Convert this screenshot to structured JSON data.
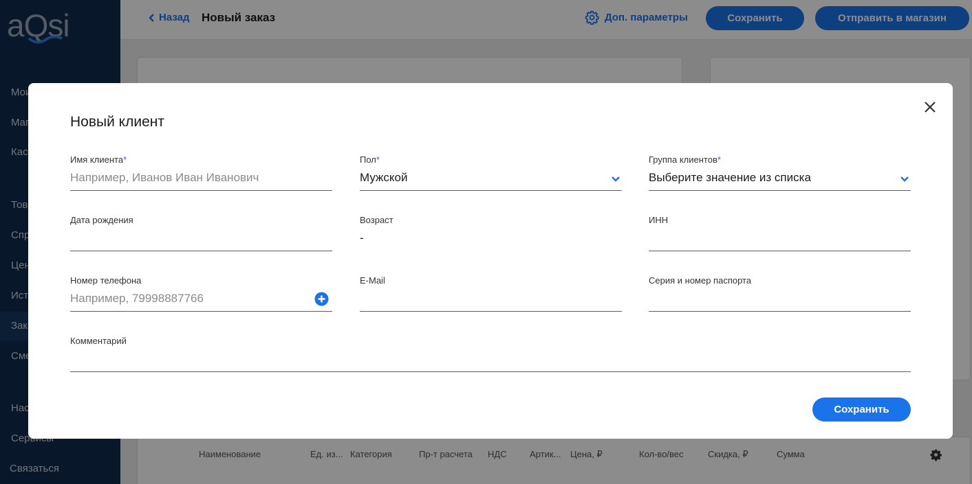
{
  "brand": {
    "logo": "aQsi"
  },
  "sidebar": {
    "items": [
      {
        "label": "Мои"
      },
      {
        "label": "Маг"
      },
      {
        "label": "Кас"
      },
      {
        "label": "Тов"
      },
      {
        "label": "Спр"
      },
      {
        "label": "Цен"
      },
      {
        "label": "Ист"
      },
      {
        "label": "Зак"
      },
      {
        "label": "Сме"
      },
      {
        "label": "Нас"
      },
      {
        "label": "Сервисы"
      },
      {
        "label": "Связаться"
      }
    ]
  },
  "header": {
    "back_label": "Назад",
    "title": "Новый заказ",
    "extra_params_label": "Доп. параметры",
    "save_label": "Сохранить",
    "send_label": "Отправить в магазин"
  },
  "table": {
    "columns": [
      "Наименование",
      "Ед. из...",
      "Категория",
      "Пр-т расчета",
      "НДС",
      "Артик...",
      "Цена, ₽",
      "Кол-во/вес",
      "Скидка, ₽",
      "Сумма"
    ]
  },
  "modal": {
    "title": "Новый клиент",
    "required_mark": "*",
    "fields": {
      "name": {
        "label": "Имя клиента",
        "placeholder": "Например, Иванов Иван Иванович"
      },
      "gender": {
        "label": "Пол",
        "value": "Мужской"
      },
      "group": {
        "label": "Группа клиентов",
        "placeholder": "Выберите значение из списка"
      },
      "birth": {
        "label": "Дата рождения",
        "value": ""
      },
      "age": {
        "label": "Возраст",
        "value": "-"
      },
      "inn": {
        "label": "ИНН",
        "value": ""
      },
      "phone": {
        "label": "Номер телефона",
        "placeholder": "Например, 79998887766"
      },
      "email": {
        "label": "E-Mail",
        "value": ""
      },
      "passport": {
        "label": "Серия и номер паспорта",
        "value": ""
      },
      "comment": {
        "label": "Комментарий",
        "value": ""
      }
    },
    "save_label": "Сохранить"
  },
  "colors": {
    "accent": "#1a73e8",
    "sidebar": "#0f2a4d"
  },
  "icons": [
    "chevron-left-icon",
    "gear-icon",
    "close-icon",
    "chevron-down-icon",
    "plus-circle-icon"
  ]
}
